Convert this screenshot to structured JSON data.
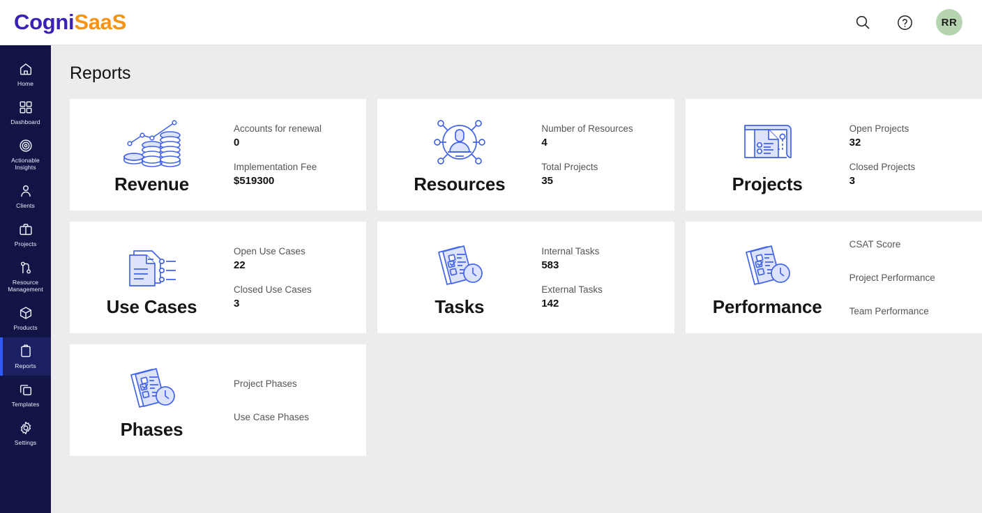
{
  "header": {
    "logo_part1": "Cogni",
    "logo_part2": "SaaS",
    "search_icon": "search-icon",
    "help_icon": "help-circle-icon",
    "avatar_initials": "RR",
    "avatar_color": "#b6d4af",
    "logo_color_1": "#3c1fb4",
    "logo_color_2": "#f79314"
  },
  "sidebar": {
    "active_index": 7,
    "accent": "#2f5bf5",
    "background": "#111444",
    "items": [
      {
        "label": "Home",
        "icon": "home-icon"
      },
      {
        "label": "Dashboard",
        "icon": "grid-icon"
      },
      {
        "label": "Actionable Insights",
        "icon": "target-icon"
      },
      {
        "label": "Clients",
        "icon": "user-icon"
      },
      {
        "label": "Projects",
        "icon": "briefcase-icon"
      },
      {
        "label": "Resource Management",
        "icon": "resource-node-icon"
      },
      {
        "label": "Products",
        "icon": "cube-icon"
      },
      {
        "label": "Reports",
        "icon": "clipboard-icon"
      },
      {
        "label": "Templates",
        "icon": "copy-icon"
      },
      {
        "label": "Settings",
        "icon": "gear-icon"
      }
    ]
  },
  "page": {
    "title": "Reports"
  },
  "cards": [
    {
      "title": "Revenue",
      "icon": "coins-growth-icon",
      "stats": [
        {
          "label": "Accounts for renewal",
          "value": "0"
        },
        {
          "label": "Implementation Fee",
          "value": "$519300"
        }
      ]
    },
    {
      "title": "Resources",
      "icon": "resource-network-icon",
      "stats": [
        {
          "label": "Number of Resources",
          "value": "4"
        },
        {
          "label": "Total Projects",
          "value": "35"
        }
      ]
    },
    {
      "title": "Projects",
      "icon": "project-document-icon",
      "stats": [
        {
          "label": "Open Projects",
          "value": "32"
        },
        {
          "label": "Closed Projects",
          "value": "3"
        }
      ]
    },
    {
      "title": "Use Cases",
      "icon": "usecase-document-icon",
      "stats": [
        {
          "label": "Open Use Cases",
          "value": "22"
        },
        {
          "label": "Closed Use Cases",
          "value": "3"
        }
      ]
    },
    {
      "title": "Tasks",
      "icon": "tasks-clock-icon",
      "stats": [
        {
          "label": "Internal Tasks",
          "value": "583"
        },
        {
          "label": "External Tasks",
          "value": "142"
        }
      ]
    },
    {
      "title": "Performance",
      "icon": "tasks-clock-icon",
      "links": [
        {
          "label": "CSAT Score"
        },
        {
          "label": "Project Performance"
        },
        {
          "label": "Team Performance"
        }
      ]
    },
    {
      "title": "Phases",
      "icon": "tasks-clock-icon",
      "links": [
        {
          "label": "Project Phases"
        },
        {
          "label": "Use Case Phases"
        }
      ]
    }
  ]
}
